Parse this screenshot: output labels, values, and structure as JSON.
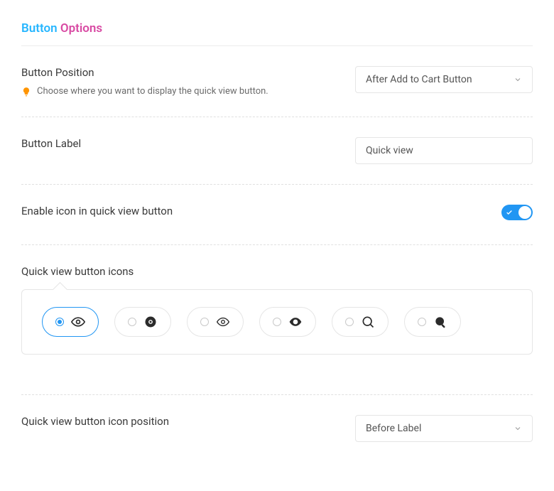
{
  "section_title": {
    "part_a": "Button ",
    "part_b": "Options"
  },
  "rows": {
    "button_position": {
      "label": "Button Position",
      "hint": "Choose where you want to display the quick view button.",
      "selected": "After Add to Cart Button"
    },
    "button_label": {
      "label": "Button Label",
      "value": "Quick view"
    },
    "enable_icon": {
      "label": "Enable icon in quick view button",
      "enabled": true
    },
    "button_icons": {
      "label": "Quick view button icons",
      "options": [
        {
          "icon": "eye-outline",
          "selected": true
        },
        {
          "icon": "eye-solid-circle",
          "selected": false
        },
        {
          "icon": "eye-outline-thin",
          "selected": false
        },
        {
          "icon": "eye-solid",
          "selected": false
        },
        {
          "icon": "magnify-outline",
          "selected": false
        },
        {
          "icon": "magnify-solid",
          "selected": false
        }
      ]
    },
    "icon_position": {
      "label": "Quick view button icon position",
      "selected": "Before Label"
    }
  },
  "colors": {
    "accent": "#2196f3",
    "hint_orange": "#ff9500"
  }
}
